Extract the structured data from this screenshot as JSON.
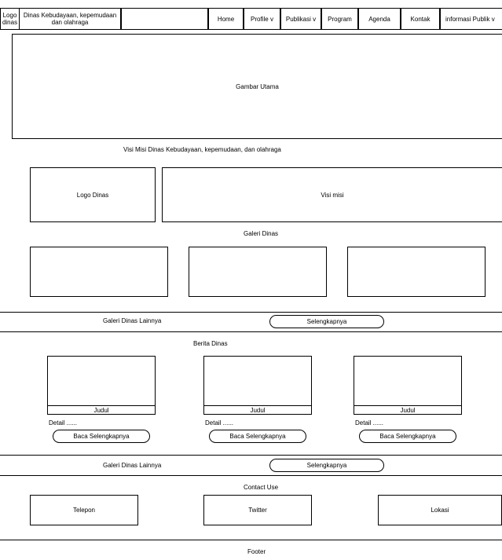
{
  "nav": {
    "logo": "Logo dinas",
    "site_title": "Dinas Kebudayaan, kepemudaan dan olahraga",
    "items": [
      "Home",
      "Profile v",
      "Publikasi v",
      "Program",
      "Agenda",
      "Kontak",
      "informasi Publik v"
    ]
  },
  "hero": {
    "label": "Gambar Utama"
  },
  "visi": {
    "heading": "Visi Misi Dinas Kebudayaan, kepemudaan, dan olahraga",
    "logo_label": "Logo Dinas",
    "visi_label": "Visi misi"
  },
  "galeri": {
    "heading": "Galeri Dinas",
    "more_label": "Galeri Dinas Lainnya",
    "more_button": "Selengkapnya"
  },
  "berita": {
    "heading": "Berita Dinas",
    "cards": [
      {
        "title": "Judul",
        "detail": "Detail ......",
        "button": "Baca Selengkapnya"
      },
      {
        "title": "Judul",
        "detail": "Detail ......",
        "button": "Baca Selengkapnya"
      },
      {
        "title": "Judul",
        "detail": "Detail ......",
        "button": "Baca Selengkapnya"
      }
    ],
    "more_label": "Galeri Dinas Lainnya",
    "more_button": "Selengkapnya"
  },
  "contact": {
    "heading": "Contact Use",
    "items": [
      "Telepon",
      "Twitter",
      "Lokasi"
    ]
  },
  "footer": {
    "label": "Footer"
  }
}
